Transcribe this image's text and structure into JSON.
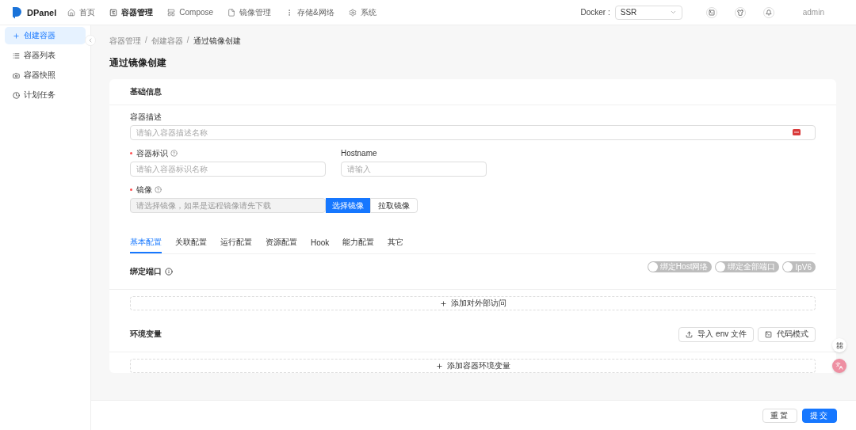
{
  "header": {
    "logo": "DPanel",
    "nav": [
      {
        "label": "首页",
        "selected": false
      },
      {
        "label": "容器管理",
        "selected": true
      },
      {
        "label": "Compose",
        "selected": false
      },
      {
        "label": "镜像管理",
        "selected": false
      },
      {
        "label": "存储&网络",
        "selected": false
      },
      {
        "label": "系统",
        "selected": false
      }
    ],
    "docker_label": "Docker :",
    "docker_value": "SSR",
    "user": "admin"
  },
  "sidebar": {
    "items": [
      {
        "label": "创建容器",
        "selected": true
      },
      {
        "label": "容器列表",
        "selected": false
      },
      {
        "label": "容器快照",
        "selected": false
      },
      {
        "label": "计划任务",
        "selected": false
      }
    ]
  },
  "breadcrumb": {
    "separator": "/",
    "items": [
      "容器管理",
      "创建容器",
      "通过镜像创建"
    ]
  },
  "page_title": "通过镜像创建",
  "basic_info": {
    "heading": "基础信息",
    "description": {
      "label": "容器描述",
      "placeholder": "请输入容器描述名称"
    },
    "identifier": {
      "label": "容器标识",
      "required": true,
      "placeholder": "请输入容器标识名称"
    },
    "hostname": {
      "label": "Hostname",
      "placeholder": "请输入"
    },
    "image": {
      "label": "镜像",
      "required": true,
      "placeholder": "请选择镜像，如果是远程镜像请先下载",
      "select_button": "选择镜像",
      "pull_button": "拉取镜像"
    }
  },
  "tabs": [
    {
      "label": "基本配置",
      "selected": true
    },
    {
      "label": "关联配置",
      "selected": false
    },
    {
      "label": "运行配置",
      "selected": false
    },
    {
      "label": "资源配置",
      "selected": false
    },
    {
      "label": "Hook",
      "selected": false
    },
    {
      "label": "能力配置",
      "selected": false
    },
    {
      "label": "其它",
      "selected": false
    }
  ],
  "ports": {
    "heading": "绑定端口",
    "switches": [
      {
        "label": "绑定Host网络",
        "on": false
      },
      {
        "label": "绑定全部端口",
        "on": false
      },
      {
        "label": "IpV6",
        "on": false
      }
    ],
    "add_button": "添加对外部访问"
  },
  "env": {
    "heading": "环境变量",
    "import_button": "导入 env 文件",
    "code_button": "代码模式",
    "add_button": "添加容器环境变量"
  },
  "footer": {
    "reset": "重置",
    "submit": "提交"
  }
}
